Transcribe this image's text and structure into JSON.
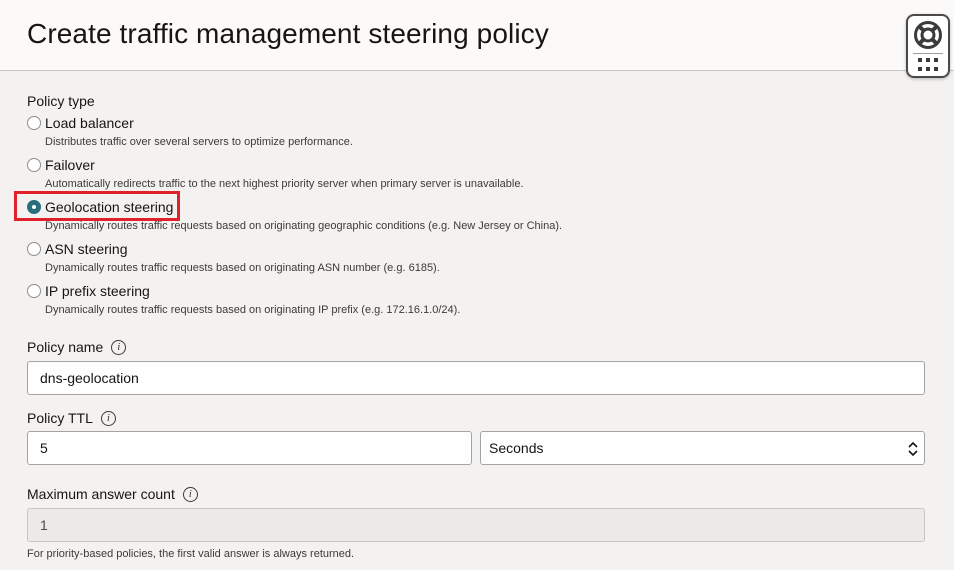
{
  "header": {
    "title": "Create traffic management steering policy"
  },
  "policy_type": {
    "label": "Policy type",
    "selected": "Geolocation steering",
    "options": [
      {
        "label": "Load balancer",
        "description": "Distributes traffic over several servers to optimize performance.",
        "checked": false
      },
      {
        "label": "Failover",
        "description": "Automatically redirects traffic to the next highest priority server when primary server is unavailable.",
        "checked": false
      },
      {
        "label": "Geolocation steering",
        "description": "Dynamically routes traffic requests based on originating geographic conditions (e.g. New Jersey or China).",
        "checked": true
      },
      {
        "label": "ASN steering",
        "description": "Dynamically routes traffic requests based on originating ASN number (e.g. 6185).",
        "checked": false
      },
      {
        "label": "IP prefix steering",
        "description": "Dynamically routes traffic requests based on originating IP prefix (e.g. 172.16.1.0/24).",
        "checked": false
      }
    ]
  },
  "policy_name": {
    "label": "Policy name",
    "value": "dns-geolocation"
  },
  "policy_ttl": {
    "label": "Policy TTL",
    "value": "5",
    "unit": "Seconds"
  },
  "max_answer_count": {
    "label": "Maximum answer count",
    "value": "1",
    "help": "For priority-based policies, the first valid answer is always returned."
  },
  "icons": {
    "info": "i",
    "help": "lifebuoy-icon",
    "apps": "grid-icon"
  },
  "colors": {
    "accent": "#2a6d7c",
    "highlight": "#e0202a",
    "background": "#f3f2f0",
    "header": "#fbfaf9"
  }
}
